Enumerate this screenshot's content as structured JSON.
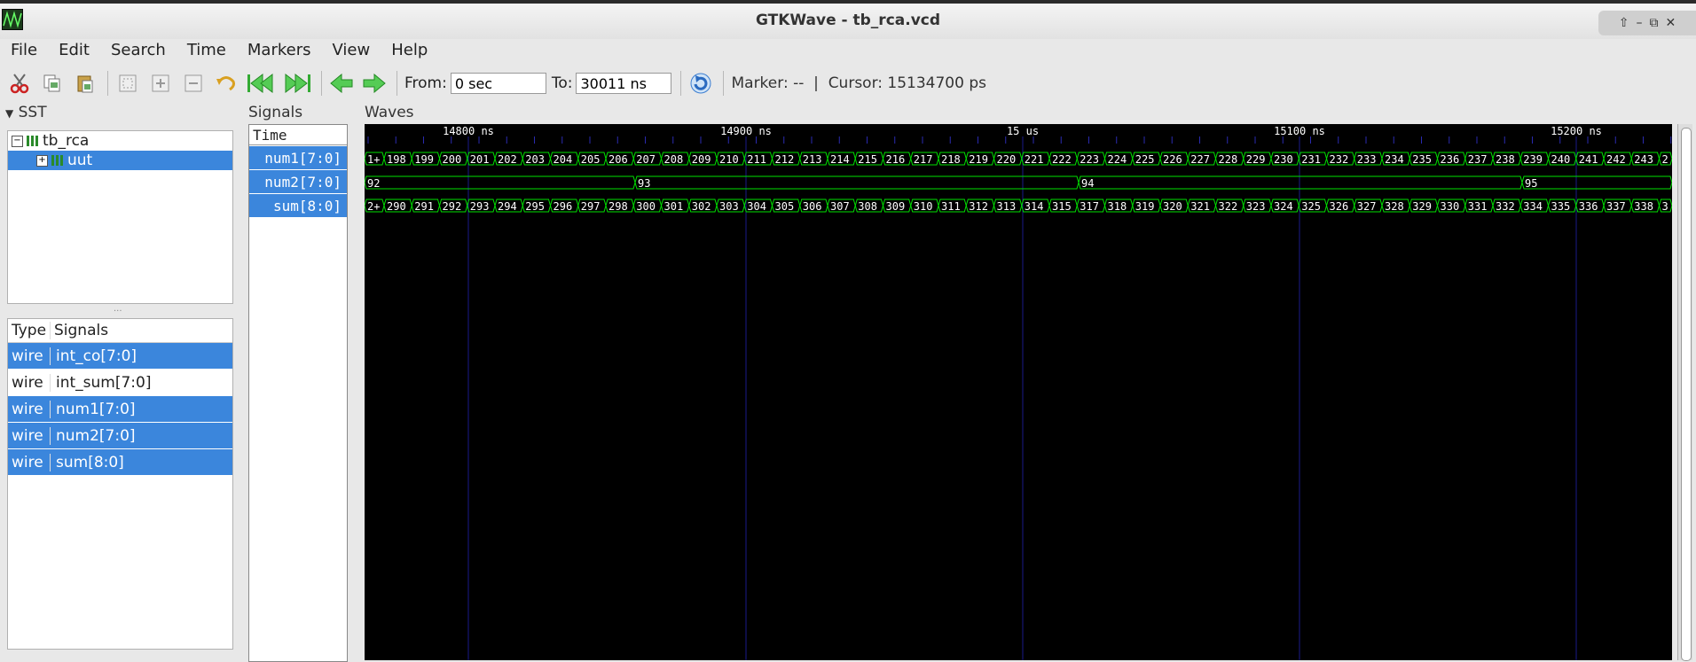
{
  "window": {
    "title": "GTKWave - tb_rca.vcd",
    "controls": [
      "⇧",
      "–",
      "⧉",
      "✕"
    ]
  },
  "menu": [
    "File",
    "Edit",
    "Search",
    "Time",
    "Markers",
    "View",
    "Help"
  ],
  "toolbar": {
    "icons": [
      "cut-icon",
      "copy-icon",
      "paste-icon",
      "zoom-fit-icon",
      "zoom-in-icon",
      "zoom-out-icon",
      "undo-zoom-icon",
      "zoom-start-icon",
      "zoom-end-icon",
      "prev-edge-icon",
      "next-edge-icon"
    ],
    "from_label": "From:",
    "from_value": "0 sec",
    "to_label": "To:",
    "to_value": "30011 ns",
    "marker_text": "Marker: --  |  Cursor: 15134700 ps"
  },
  "sst": {
    "label": "SST",
    "tree": [
      {
        "name": "tb_rca",
        "expander": "−"
      },
      {
        "name": "uut",
        "expander": "+"
      }
    ],
    "headers": {
      "type": "Type",
      "signals": "Signals"
    },
    "signals": [
      {
        "type": "wire",
        "name": "int_co[7:0]",
        "selected": true
      },
      {
        "type": "wire",
        "name": "int_sum[7:0]",
        "selected": false
      },
      {
        "type": "wire",
        "name": "num1[7:0]",
        "selected": true
      },
      {
        "type": "wire",
        "name": "num2[7:0]",
        "selected": true
      },
      {
        "type": "wire",
        "name": "sum[8:0]",
        "selected": true
      }
    ]
  },
  "signals_pane": {
    "label": "Signals",
    "time": "Time",
    "names": [
      "num1[7:0]",
      "num2[7:0]",
      "sum[8:0]"
    ]
  },
  "waves": {
    "label": "Waves",
    "time_labels": [
      "14800 ns",
      "14900 ns",
      "15 us",
      "15100 ns",
      "15200 ns"
    ],
    "num1": [
      "1+",
      "198",
      "199",
      "200",
      "201",
      "202",
      "203",
      "204",
      "205",
      "206",
      "207",
      "208",
      "209",
      "210",
      "211",
      "212",
      "213",
      "214",
      "215",
      "216",
      "217",
      "218",
      "219",
      "220",
      "221",
      "222",
      "223",
      "224",
      "225",
      "226",
      "227",
      "228",
      "229",
      "230",
      "231",
      "232",
      "233",
      "234",
      "235",
      "236",
      "237",
      "238",
      "239",
      "240",
      "241",
      "242",
      "243",
      "2"
    ],
    "num2": [
      "92",
      "93",
      "94",
      "95"
    ],
    "sum": [
      "2+",
      "290",
      "291",
      "292",
      "293",
      "294",
      "295",
      "296",
      "297",
      "298",
      "300",
      "301",
      "302",
      "303",
      "304",
      "305",
      "306",
      "307",
      "308",
      "309",
      "310",
      "311",
      "312",
      "313",
      "314",
      "315",
      "317",
      "318",
      "319",
      "320",
      "321",
      "322",
      "323",
      "324",
      "325",
      "326",
      "327",
      "328",
      "329",
      "330",
      "331",
      "332",
      "334",
      "335",
      "336",
      "337",
      "338",
      "3"
    ],
    "trace_color": "#00e000"
  }
}
